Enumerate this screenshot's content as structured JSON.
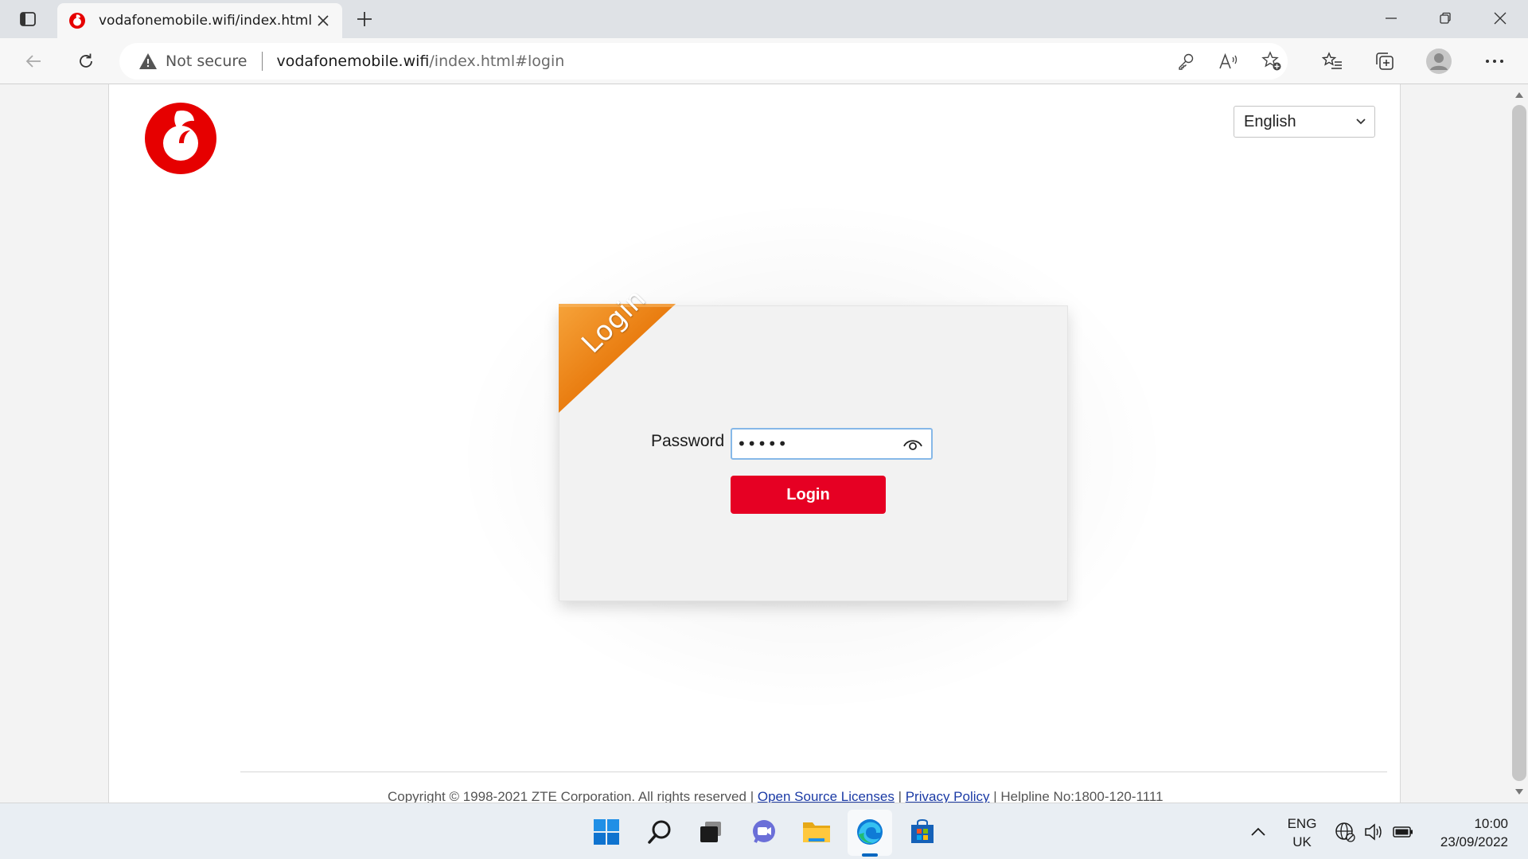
{
  "browser": {
    "tab_title": "vodafonemobile.wifi/index.html",
    "security_label": "Not secure",
    "url_host": "vodafonemobile.wifi",
    "url_path": "/index.html#login"
  },
  "page": {
    "language_selected": "English",
    "ribbon_label": "Login",
    "password_label": "Password",
    "password_value": "•••••",
    "login_button": "Login",
    "footer": {
      "copyright": "Copyright © 1998-2021 ZTE Corporation. All rights reserved",
      "sep1": " | ",
      "open_source": "Open Source Licenses",
      "sep2": " | ",
      "privacy": "Privacy Policy",
      "sep3": " | ",
      "helpline": "Helpline No:1800-120-1111"
    },
    "accent_color": "#e60023",
    "ribbon_color": "#e8790c"
  },
  "taskbar": {
    "lang_line1": "ENG",
    "lang_line2": "UK",
    "time": "10:00",
    "date": "23/09/2022",
    "icons": [
      "windows-start-icon",
      "search-icon",
      "task-view-icon",
      "chat-icon",
      "file-explorer-icon",
      "edge-icon",
      "store-icon"
    ]
  }
}
